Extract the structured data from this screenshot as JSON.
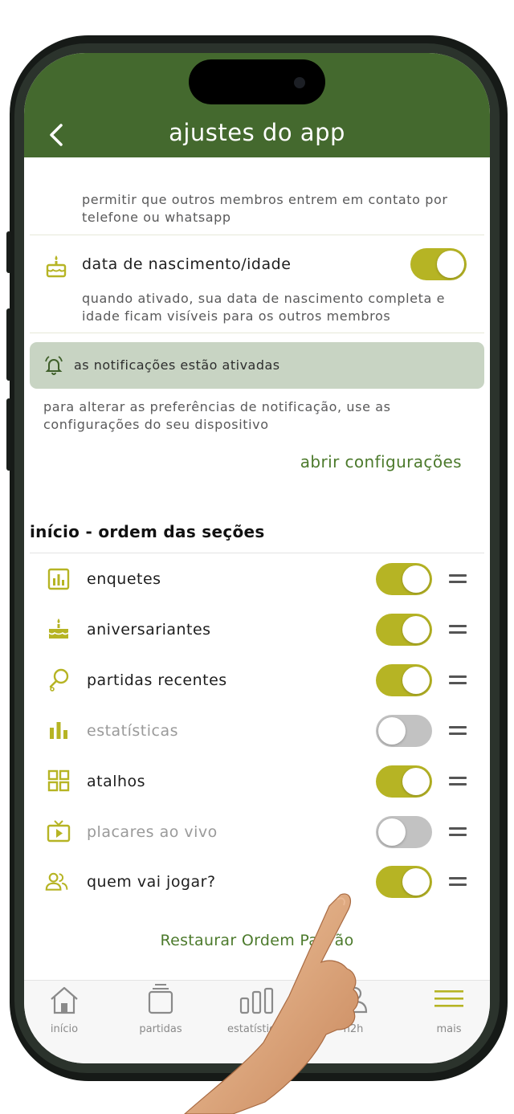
{
  "header": {
    "title": "ajustes do app",
    "back_icon": "chevron-left-icon"
  },
  "contact_section": {
    "description": "permitir que outros membros entrem em contato por telefone ou whatsapp"
  },
  "birthday_setting": {
    "icon": "cake-icon",
    "label": "data de nascimento/idade",
    "enabled": true,
    "description": "quando ativado, sua data de nascimento completa e idade ficam visíveis para os outros membros"
  },
  "notifications": {
    "icon": "bell-ring-icon",
    "status": "as notificações estão ativadas",
    "hint": "para alterar as preferências de notificação, use as configurações do seu dispositivo",
    "open_settings_link": "abrir configurações"
  },
  "home_order": {
    "title": "início - ordem das seções",
    "items": [
      {
        "label": "enquetes",
        "icon": "poll-chart-icon",
        "enabled": true
      },
      {
        "label": "aniversariantes",
        "icon": "cake-icon",
        "enabled": true
      },
      {
        "label": "partidas recentes",
        "icon": "racket-icon",
        "enabled": true
      },
      {
        "label": "estatísticas",
        "icon": "bar-chart-icon",
        "enabled": false
      },
      {
        "label": "atalhos",
        "icon": "grid-icon",
        "enabled": true
      },
      {
        "label": "placares ao vivo",
        "icon": "tv-icon",
        "enabled": false
      },
      {
        "label": "quem vai jogar?",
        "icon": "people-icon",
        "enabled": true
      }
    ],
    "restore_button": "Restaurar Ordem Padrão"
  },
  "tabbar": {
    "tabs": [
      {
        "label": "início",
        "icon": "home-icon"
      },
      {
        "label": "partidas",
        "icon": "cards-stack-icon"
      },
      {
        "label": "estatísticas",
        "icon": "stats-icon"
      },
      {
        "label": "h2h",
        "icon": "users-icon"
      },
      {
        "label": "mais",
        "icon": "menu-icon",
        "active": true
      }
    ]
  },
  "colors": {
    "header_green": "#44692e",
    "accent_olive": "#b6b424",
    "link_green": "#4c7a2c",
    "notif_bg": "#c8d4c3",
    "toggle_off": "#c2c2c2"
  }
}
